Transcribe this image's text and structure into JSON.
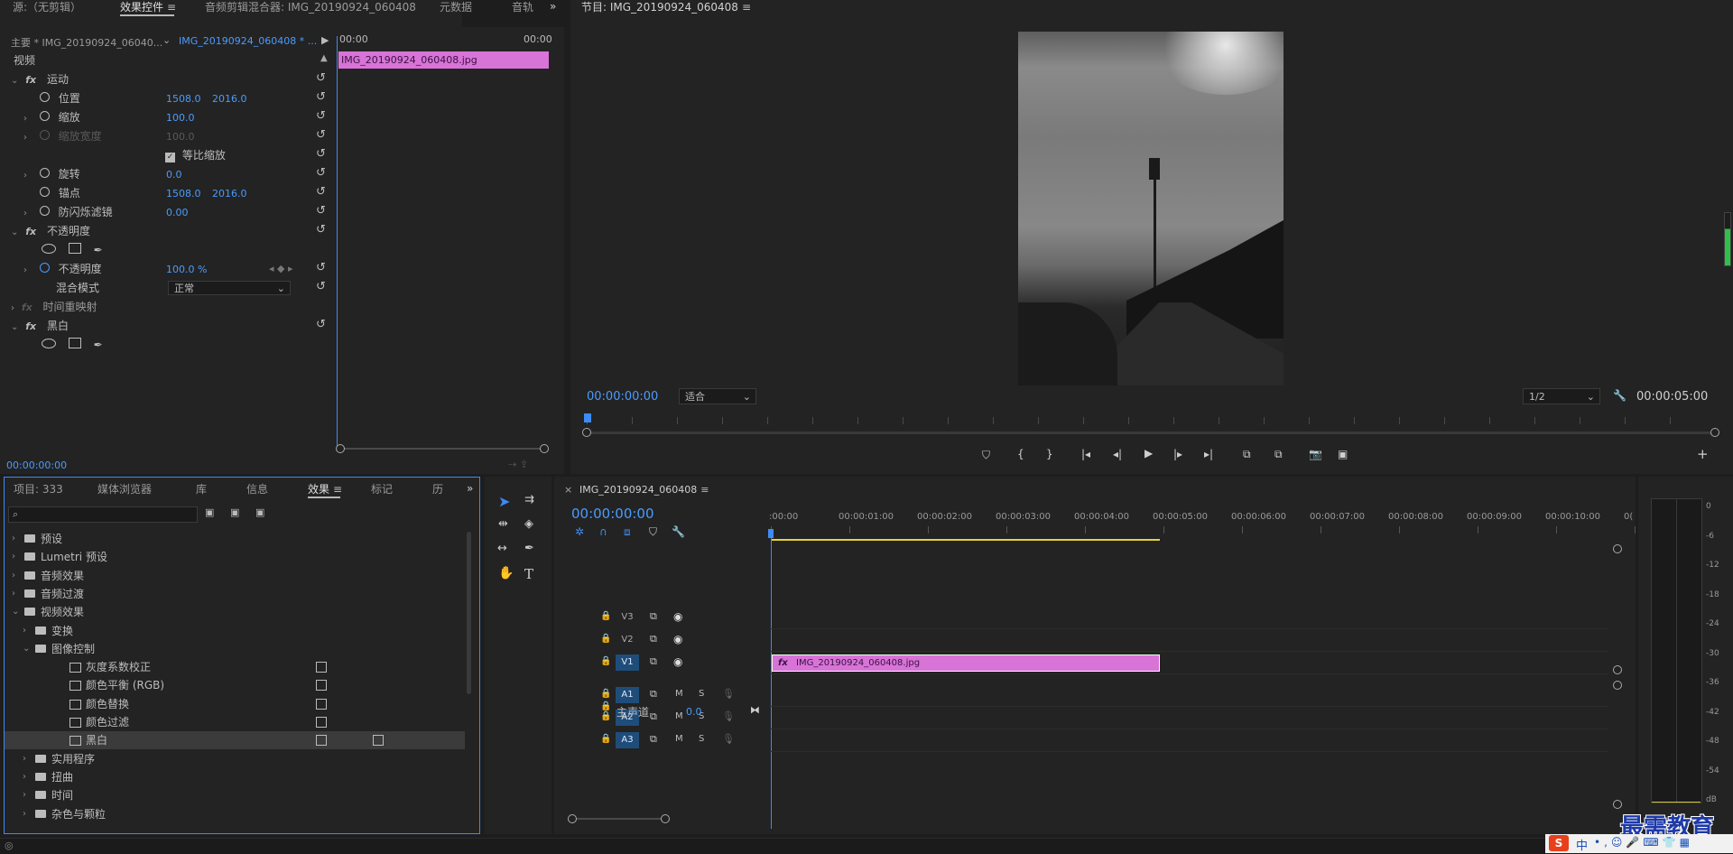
{
  "effect_controls": {
    "tabs": [
      {
        "label": "源:（无剪辑）"
      },
      {
        "label": "效果控件"
      },
      {
        "label": "音频剪辑混合器: IMG_20190924_060408"
      },
      {
        "label": "元数据"
      },
      {
        "label": "音轨"
      }
    ],
    "active_tab": "效果控件",
    "overflow": "»",
    "master_label": "主要 * IMG_20190924_06040...",
    "sequence_clip": "IMG_20190924_060408 * ...",
    "mini_timeline_start": "00:00",
    "mini_timeline_end": "00:00",
    "clip_name": "IMG_20190924_060408.jpg",
    "section_video": "视频",
    "motion_label": "运动",
    "position_label": "位置",
    "position_x": "1508.0",
    "position_y": "2016.0",
    "scale_label": "缩放",
    "scale_value": "100.0",
    "scale_width_label": "缩放宽度",
    "scale_width_value": "100.0",
    "uniform_scale_label": "等比缩放",
    "rotation_label": "旋转",
    "rotation_value": "0.0",
    "anchor_label": "锚点",
    "anchor_x": "1508.0",
    "anchor_y": "2016.0",
    "antiflicker_label": "防闪烁滤镜",
    "antiflicker_value": "0.00",
    "opacity_group_label": "不透明度",
    "opacity_label": "不透明度",
    "opacity_value": "100.0 %",
    "blend_mode_label": "混合模式",
    "blend_mode_value": "正常",
    "time_remap_label": "时间重映射",
    "bw_label": "黑白",
    "timecode": "00:00:00:00"
  },
  "program_monitor": {
    "title": "节目: IMG_20190924_060408",
    "timecode_left": "00:00:00:00",
    "fit_value": "适合",
    "resolution_value": "1/2",
    "timecode_right": "00:00:05:00"
  },
  "effects_panel": {
    "tabs": [
      {
        "label": "项目: 333"
      },
      {
        "label": "媒体浏览器"
      },
      {
        "label": "库"
      },
      {
        "label": "信息"
      },
      {
        "label": "效果"
      },
      {
        "label": "标记"
      },
      {
        "label": "历"
      }
    ],
    "search_placeholder": "",
    "items": [
      {
        "label": "预设"
      },
      {
        "label": "Lumetri 预设"
      },
      {
        "label": "音频效果"
      },
      {
        "label": "音频过渡"
      },
      {
        "label": "视频效果"
      },
      {
        "label": "变换"
      },
      {
        "label": "图像控制"
      },
      {
        "label": "灰度系数校正"
      },
      {
        "label": "颜色平衡 (RGB)"
      },
      {
        "label": "颜色替换"
      },
      {
        "label": "颜色过滤"
      },
      {
        "label": "黑白"
      },
      {
        "label": "实用程序"
      },
      {
        "label": "扭曲"
      },
      {
        "label": "时间"
      },
      {
        "label": "杂色与颗粒"
      }
    ]
  },
  "timeline": {
    "seq_name": "IMG_20190924_060408",
    "timecode": "00:00:00:00",
    "ruler": [
      ":00:00",
      "00:00:01:00",
      "00:00:02:00",
      "00:00:03:00",
      "00:00:04:00",
      "00:00:05:00",
      "00:00:06:00",
      "00:00:07:00",
      "00:00:08:00",
      "00:00:09:00",
      "00:00:10:00",
      "0("
    ],
    "tracks_video": [
      "V3",
      "V2",
      "V1"
    ],
    "tracks_audio": [
      "A1",
      "A2",
      "A3"
    ],
    "mute_label": "M",
    "solo_label": "S",
    "master_label": "主声道",
    "master_value": "0.0",
    "clip_name": "IMG_20190924_060408.jpg"
  },
  "meters": {
    "labels": [
      "0",
      "-6",
      "-12",
      "-18",
      "-24",
      "-30",
      "-36",
      "-42",
      "-48",
      "-54",
      "dB"
    ]
  },
  "watermark": {
    "text": "最需教育",
    "ime_label": "中"
  },
  "colors": {
    "accent_blue": "#4a9bff",
    "clip_pink": "#d873d8",
    "track_blue": "#1f4d7a"
  }
}
